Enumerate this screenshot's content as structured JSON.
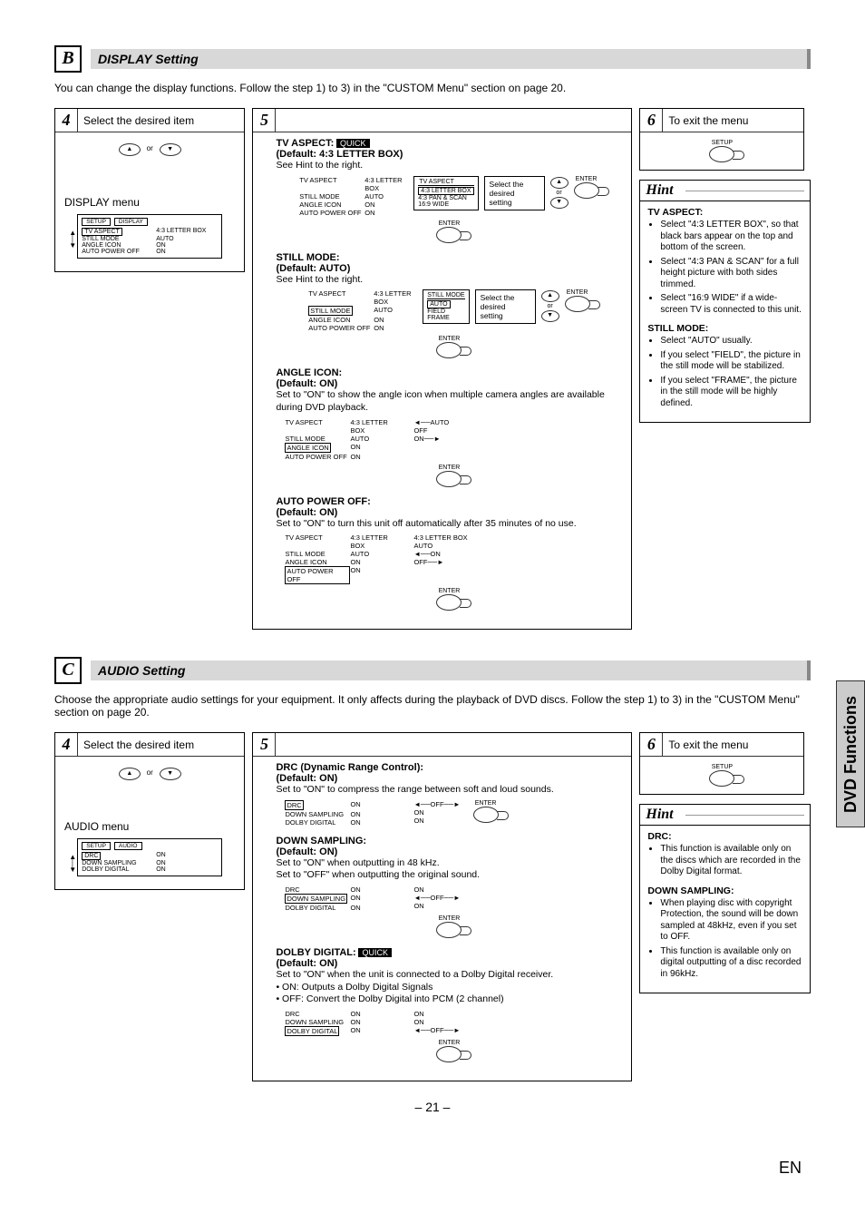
{
  "side_tab": "DVD Functions",
  "page_number": "– 21 –",
  "lang": "EN",
  "sectionB": {
    "letter": "B",
    "title": "DISPLAY Setting",
    "intro": "You can change the display functions. Follow the step 1) to 3) in the \"CUSTOM Menu\" section on page 20.",
    "step4": {
      "num": "4",
      "head": "Select the desired item",
      "or": "or",
      "menu_title": "DISPLAY menu",
      "osd_tabs": [
        "SETUP",
        "DISPLAY"
      ],
      "osd_rows": [
        {
          "l": "TV ASPECT",
          "r": "4:3 LETTER BOX"
        },
        {
          "l": "STILL MODE",
          "r": "AUTO"
        },
        {
          "l": "ANGLE ICON",
          "r": "ON"
        },
        {
          "l": "AUTO POWER OFF",
          "r": "ON"
        }
      ]
    },
    "step5": {
      "num": "5",
      "tv_aspect": {
        "title": "TV ASPECT:",
        "quick": "QUICK",
        "default": "(Default: 4:3 LETTER BOX)",
        "hint": "See Hint to the right.",
        "select": "Select the desired setting",
        "opts_label": "TV ASPECT",
        "opts": [
          "4:3 LETTER BOX",
          "4:3 PAN & SCAN",
          "16:9 WIDE"
        ],
        "or": "or",
        "enter": "ENTER"
      },
      "still_mode": {
        "title": "STILL MODE:",
        "default": "(Default: AUTO)",
        "hint": "See Hint to the right.",
        "select": "Select the desired setting",
        "opts_label": "STILL MODE",
        "opts": [
          "AUTO",
          "FIELD",
          "FRAME"
        ],
        "or": "or",
        "enter": "ENTER"
      },
      "angle_icon": {
        "title": "ANGLE ICON:",
        "default": "(Default: ON)",
        "desc": "Set to \"ON\" to show the angle icon when multiple camera angles are available during DVD playback.",
        "opts": [
          "AUTO",
          "OFF",
          "ON"
        ],
        "enter": "ENTER",
        "table": [
          {
            "l": "TV ASPECT",
            "r": "4:3 LETTER BOX"
          },
          {
            "l": "STILL MODE",
            "r": "AUTO"
          },
          {
            "l": "ANGLE ICON",
            "r": "ON",
            "sel": true
          },
          {
            "l": "AUTO POWER OFF",
            "r": "ON"
          }
        ]
      },
      "auto_power": {
        "title": "AUTO POWER OFF:",
        "default": "(Default: ON)",
        "desc": "Set to \"ON\" to turn this unit off automatically after 35 minutes of no use.",
        "enter": "ENTER",
        "table": [
          {
            "l": "TV ASPECT",
            "r": "4:3 LETTER BOX"
          },
          {
            "l": "STILL MODE",
            "r": "AUTO"
          },
          {
            "l": "ANGLE ICON",
            "r": "ON"
          },
          {
            "l": "AUTO POWER OFF",
            "r": "ON",
            "sel": true
          }
        ],
        "col3": [
          "4:3 LETTER BOX",
          "AUTO",
          "ON",
          "OFF"
        ]
      },
      "enter_label": "ENTER"
    },
    "step6": {
      "num": "6",
      "head": "To exit the menu",
      "setup": "SETUP"
    },
    "hint": {
      "title": "Hint",
      "tv_head": "TV ASPECT:",
      "tv": [
        "Select \"4:3 LETTER BOX\", so that black bars appear on the top and bottom of the screen.",
        "Select \"4:3 PAN & SCAN\" for a full height picture with both sides trimmed.",
        "Select \"16:9 WIDE\" if a wide-screen TV is connected to this unit."
      ],
      "still_head": "STILL MODE:",
      "still": [
        "Select \"AUTO\" usually.",
        "If you select \"FIELD\", the picture in the still mode will be stabilized.",
        "If you select \"FRAME\", the picture in the still mode will be highly defined."
      ]
    }
  },
  "sectionC": {
    "letter": "C",
    "title": "AUDIO Setting",
    "intro": "Choose the appropriate audio settings for your equipment. It only affects during the playback of DVD discs. Follow the step 1) to 3) in the \"CUSTOM Menu\" section on page 20.",
    "step4": {
      "num": "4",
      "head": "Select the desired item",
      "or": "or",
      "menu_title": "AUDIO menu",
      "osd_tabs": [
        "SETUP",
        "AUDIO"
      ],
      "osd_rows": [
        {
          "l": "DRC",
          "r": "ON"
        },
        {
          "l": "DOWN SAMPLING",
          "r": "ON"
        },
        {
          "l": "DOLBY DIGITAL",
          "r": "ON"
        }
      ]
    },
    "step5": {
      "num": "5",
      "drc": {
        "title": "DRC (Dynamic Range Control):",
        "default": "(Default: ON)",
        "desc": "Set to \"ON\" to compress the range between soft and loud sounds.",
        "enter": "ENTER",
        "rows": [
          {
            "l": "DRC",
            "r": "ON",
            "sel": true
          },
          {
            "l": "DOWN SAMPLING",
            "r": "ON"
          },
          {
            "l": "DOLBY DIGITAL",
            "r": "ON"
          }
        ],
        "col3": [
          "OFF",
          "ON",
          "ON"
        ]
      },
      "down": {
        "title": "DOWN SAMPLING:",
        "default": "(Default: ON)",
        "desc1": "Set to \"ON\" when outputting in 48 kHz.",
        "desc2": "Set to \"OFF\" when outputting the original sound.",
        "enter": "ENTER",
        "rows": [
          {
            "l": "DRC",
            "r": "ON"
          },
          {
            "l": "DOWN SAMPLING",
            "r": "ON",
            "sel": true
          },
          {
            "l": "DOLBY DIGITAL",
            "r": "ON"
          }
        ],
        "col3": [
          "ON",
          "OFF",
          "ON"
        ]
      },
      "dolby": {
        "title": "DOLBY DIGITAL:",
        "quick": "QUICK",
        "default": "(Default: ON)",
        "desc": "Set to \"ON\" when the unit is connected to a Dolby Digital receiver.",
        "on": "• ON: Outputs a Dolby Digital Signals",
        "off": "• OFF: Convert the Dolby Digital into PCM (2 channel)",
        "enter": "ENTER",
        "rows": [
          {
            "l": "DRC",
            "r": "ON"
          },
          {
            "l": "DOWN SAMPLING",
            "r": "ON"
          },
          {
            "l": "DOLBY DIGITAL",
            "r": "ON",
            "sel": true
          }
        ],
        "col3": [
          "ON",
          "ON",
          "OFF"
        ]
      }
    },
    "step6": {
      "num": "6",
      "head": "To exit the menu",
      "setup": "SETUP"
    },
    "hint": {
      "title": "Hint",
      "drc_head": "DRC:",
      "drc": [
        "This function is available only on the discs which are recorded in the Dolby Digital format."
      ],
      "down_head": "DOWN SAMPLING:",
      "down": [
        "When playing disc with copyright Protection, the sound will be down sampled at 48kHz, even if you set to OFF.",
        "This function is available only on digital outputting of a disc recorded in 96kHz."
      ]
    }
  }
}
